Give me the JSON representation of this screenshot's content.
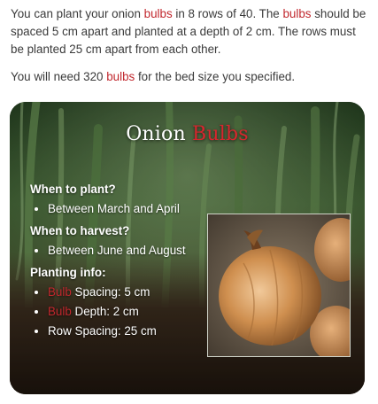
{
  "intro": {
    "p1_before_1": "You can plant your onion ",
    "bulbs_word": "bulbs",
    "p1_middle": " in 8 rows of 40. The ",
    "p1_after": " should be spaced 5 cm apart and planted at a depth of 2 cm. The rows must be planted 25 cm apart from each other.",
    "p2_before": "You will need 320 ",
    "p2_after": " for the bed size you specified."
  },
  "card": {
    "title_plain": "Onion ",
    "title_accent": "Bulbs",
    "when_to_plant": {
      "heading": "When to plant?",
      "items": [
        "Between March and April"
      ]
    },
    "when_to_harvest": {
      "heading": "When to harvest?",
      "items": [
        "Between June and August"
      ]
    },
    "planting_info": {
      "heading": "Planting info:",
      "bulb_word": "Bulb",
      "spacing_text": " Spacing: 5 cm",
      "depth_text": " Depth: 2 cm",
      "row_spacing": "Row Spacing: 25 cm"
    }
  },
  "colors": {
    "accent": "#c1272d",
    "card_text": "#ffffff"
  },
  "icons": {
    "background": "onion-field-image",
    "photo": "onion-bulbs-photo"
  }
}
